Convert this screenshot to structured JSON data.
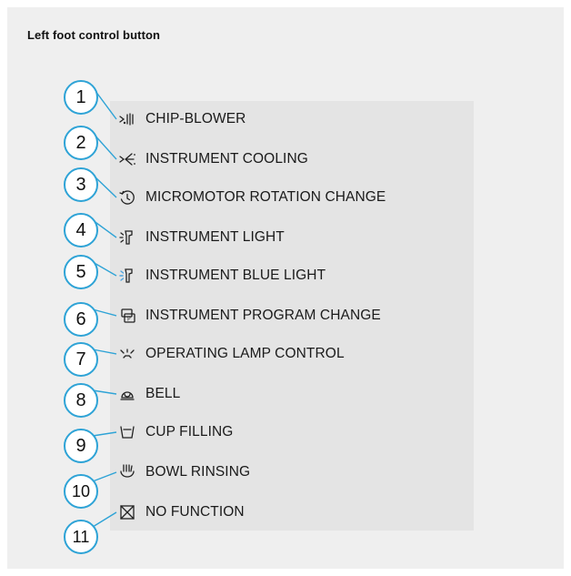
{
  "title": "Left foot control button",
  "items": [
    {
      "number": "1",
      "label": "CHIP-BLOWER",
      "icon": "chip-blower-icon"
    },
    {
      "number": "2",
      "label": "INSTRUMENT COOLING",
      "icon": "instrument-cooling-icon"
    },
    {
      "number": "3",
      "label": "MICROMOTOR ROTATION CHANGE",
      "icon": "rotation-change-icon"
    },
    {
      "number": "4",
      "label": "INSTRUMENT LIGHT",
      "icon": "instrument-light-icon"
    },
    {
      "number": "5",
      "label": "INSTRUMENT BLUE LIGHT",
      "icon": "instrument-blue-light-icon"
    },
    {
      "number": "6",
      "label": "INSTRUMENT PROGRAM CHANGE",
      "icon": "program-change-icon"
    },
    {
      "number": "7",
      "label": "OPERATING LAMP CONTROL",
      "icon": "operating-lamp-icon"
    },
    {
      "number": "8",
      "label": "BELL",
      "icon": "bell-icon"
    },
    {
      "number": "9",
      "label": "CUP FILLING",
      "icon": "cup-filling-icon"
    },
    {
      "number": "10",
      "label": "BOWL RINSING",
      "icon": "bowl-rinsing-icon"
    },
    {
      "number": "11",
      "label": "NO FUNCTION",
      "icon": "no-function-icon"
    }
  ],
  "colors": {
    "badge_border": "#2ea3d6",
    "blue_light": "#4aa3e0",
    "panel": "#efefef",
    "list": "#e4e4e4"
  }
}
